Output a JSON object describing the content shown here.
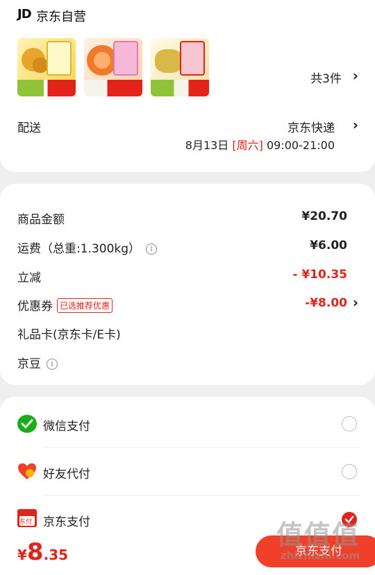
{
  "store": {
    "logo": "JD",
    "name": "京东自营",
    "item_count": "共3件",
    "arrow": "›"
  },
  "delivery": {
    "label": "配送",
    "method": "京东快递",
    "date": "8月13日",
    "weekday": "[周六]",
    "time": "09:00-21:00"
  },
  "price": {
    "goods_label": "商品金额",
    "goods_value": "¥20.70",
    "freight_label": "运费（总重:1.300kg）",
    "freight_value": "¥6.00",
    "discount_label": "立减",
    "discount_value": "- ¥10.35",
    "coupon_label": "优惠券",
    "coupon_tag": "已选推荐优惠",
    "coupon_value": "-¥8.00",
    "giftcard_label": "礼品卡(京东卡/E卡)",
    "jingdou_label": "京豆",
    "info_glyph": "i"
  },
  "payment": {
    "methods": [
      {
        "label": "微信支付",
        "selected": false
      },
      {
        "label": "好友代付",
        "selected": false
      },
      {
        "label": "京东支付",
        "selected": true
      }
    ],
    "jd_icon_text": "东付"
  },
  "footer": {
    "currency": "¥",
    "total_int": "8",
    "total_dec": ".35",
    "pay_button": "京东支付"
  },
  "watermark": {
    "big": "值值值",
    "small": "zhizhizhi.com"
  },
  "colors": {
    "accent": "#e2231a",
    "wechat": "#1aad19"
  }
}
